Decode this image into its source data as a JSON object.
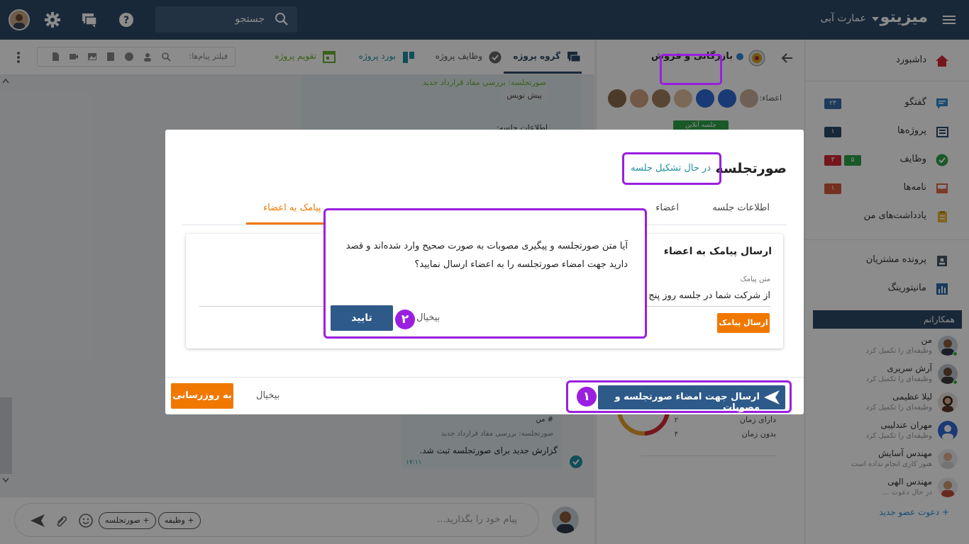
{
  "topbar": {
    "brand": "میزیتو",
    "company": "عمارت آبی",
    "search_placeholder": "جستجو"
  },
  "sidebar": {
    "items": [
      {
        "label": "داشبورد",
        "icon": "home-icon"
      },
      {
        "label": "گفتگو",
        "icon": "chat-icon",
        "badge": "۲۳"
      },
      {
        "label": "پروژه‌ها",
        "icon": "projects-icon",
        "badge": "۱"
      },
      {
        "label": "وظایف",
        "icon": "tasks-check-icon",
        "badge_red": "۳",
        "badge_green": "۵"
      },
      {
        "label": "نامه‌ها",
        "icon": "inbox-icon",
        "badge": "۱"
      },
      {
        "label": "یادداشت‌های من",
        "icon": "notes-icon"
      },
      {
        "label": "پرونده مشتریان",
        "icon": "customer-file-icon"
      },
      {
        "label": "مانیتورینگ",
        "icon": "monitoring-icon"
      }
    ],
    "colleagues_title": "همکارانم",
    "colleagues": [
      {
        "name": "من",
        "status": "وظیفه‌ای را تکمیل کرد"
      },
      {
        "name": "آرش سریری",
        "status": "وظیفه‌ای را تکمیل کرد"
      },
      {
        "name": "لیلا عظیمی",
        "status": "وظیفه‌ای را تکمیل کرد"
      },
      {
        "name": "مهران عندلیبی",
        "status": "وظیفه‌ای را تکمیل کرد"
      },
      {
        "name": "مهندس آسایش",
        "status": "هنوز کاری انجام نداده است"
      },
      {
        "name": "مهندس الهی",
        "status": "در حال دعوت ..."
      }
    ],
    "invite": "+ دعوت عضو جدید"
  },
  "midpanel": {
    "title": "بازرگانی و فروش",
    "members_label": "اعضاء:",
    "online_meeting": "جلسه آنلاین",
    "legend": [
      {
        "label": "دارای زمان",
        "count": "۲"
      },
      {
        "label": "بدون زمان",
        "count": "۴"
      }
    ]
  },
  "chat": {
    "tabs": [
      "گروه پروژه",
      "وظایف پروژه",
      "بورد پروژه",
      "تقویم پروژه"
    ],
    "filter_placeholder": "فیلتر پیام‌ها:",
    "message_top": "صورتجلسه: بررسی مفاد قرارداد جدید",
    "draft_chip": "پیش نویس",
    "meeting_info": "اطلاعات جلسه:",
    "msg_mention": "# من",
    "msg_quote": "صورتجلسه: بررسی مفاد قرارداد جدید",
    "msg_body": "گزارش جدید برای صورتجلسه ثبت شد.",
    "msg_time": "۱۷:۱۱",
    "input_placeholder": "پیام خود را بگذارید...",
    "chip_task": "+ وظیفه",
    "chip_minutes": "+ صورتجلسه"
  },
  "modal": {
    "title": "صورتجلسه",
    "status": "در حال تشکیل جلسه",
    "tabs": [
      "اطلاعات جلسه",
      "اعضاء",
      "پیامک به اعضاء"
    ],
    "sms_title": "ارسال پیامک به اعضاء",
    "sms_label": "متن پیامک",
    "sms_text": "از شرکت شما در جلسه روز پنج",
    "sms_send": "ارسال پیامک",
    "send_sign": "ارسال جهت امضاء صورتجلسه و مصوبات",
    "cancel": "بیخیال",
    "update": "به روزرسانی",
    "step1": "۱"
  },
  "confirm": {
    "text": "آیا متن صورتجلسه و پیگیری مصوبات به صورت صحیح وارد شده‌اند و قصد دارید جهت امضاء صورتجلسه را به اعضاء ارسال نمایید؟",
    "ok": "تایید",
    "cancel": "بیخیال",
    "step2": "۲"
  },
  "colors": {
    "header": "#2e4a67",
    "accent_orange": "#f07800",
    "primary_blue": "#2e5a8a",
    "highlight_purple": "#9a1fe0",
    "status_teal": "#1f8fa0"
  }
}
